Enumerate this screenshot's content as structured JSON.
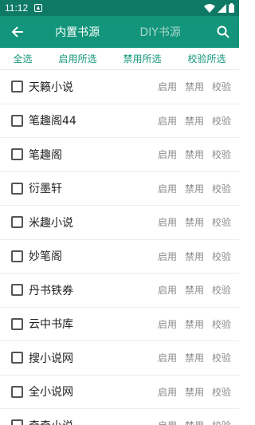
{
  "status_bar": {
    "time": "11:12",
    "icons": [
      "notification-icon",
      "wifi-icon",
      "signal-icon",
      "battery-icon"
    ]
  },
  "app_bar": {
    "tabs": [
      {
        "label": "内置书源",
        "active": true
      },
      {
        "label": "DIY书源",
        "active": false
      }
    ],
    "accent_color": "#12957a",
    "status_color": "#0e7a66"
  },
  "actions": [
    "全选",
    "启用所选",
    "禁用所选",
    "校验所选"
  ],
  "row_actions": {
    "enable": "启用",
    "disable": "禁用",
    "verify": "校验"
  },
  "sources": [
    {
      "name": "天籁小说",
      "checked": false
    },
    {
      "name": "笔趣阁44",
      "checked": false
    },
    {
      "name": "笔趣阁",
      "checked": false
    },
    {
      "name": "衍墨轩",
      "checked": false
    },
    {
      "name": "米趣小说",
      "checked": false
    },
    {
      "name": "妙笔阁",
      "checked": false
    },
    {
      "name": "丹书铁券",
      "checked": false
    },
    {
      "name": "云中书库",
      "checked": false
    },
    {
      "name": "搜小说网",
      "checked": false
    },
    {
      "name": "全小说网",
      "checked": false
    },
    {
      "name": "奇奇小说",
      "checked": false
    }
  ]
}
